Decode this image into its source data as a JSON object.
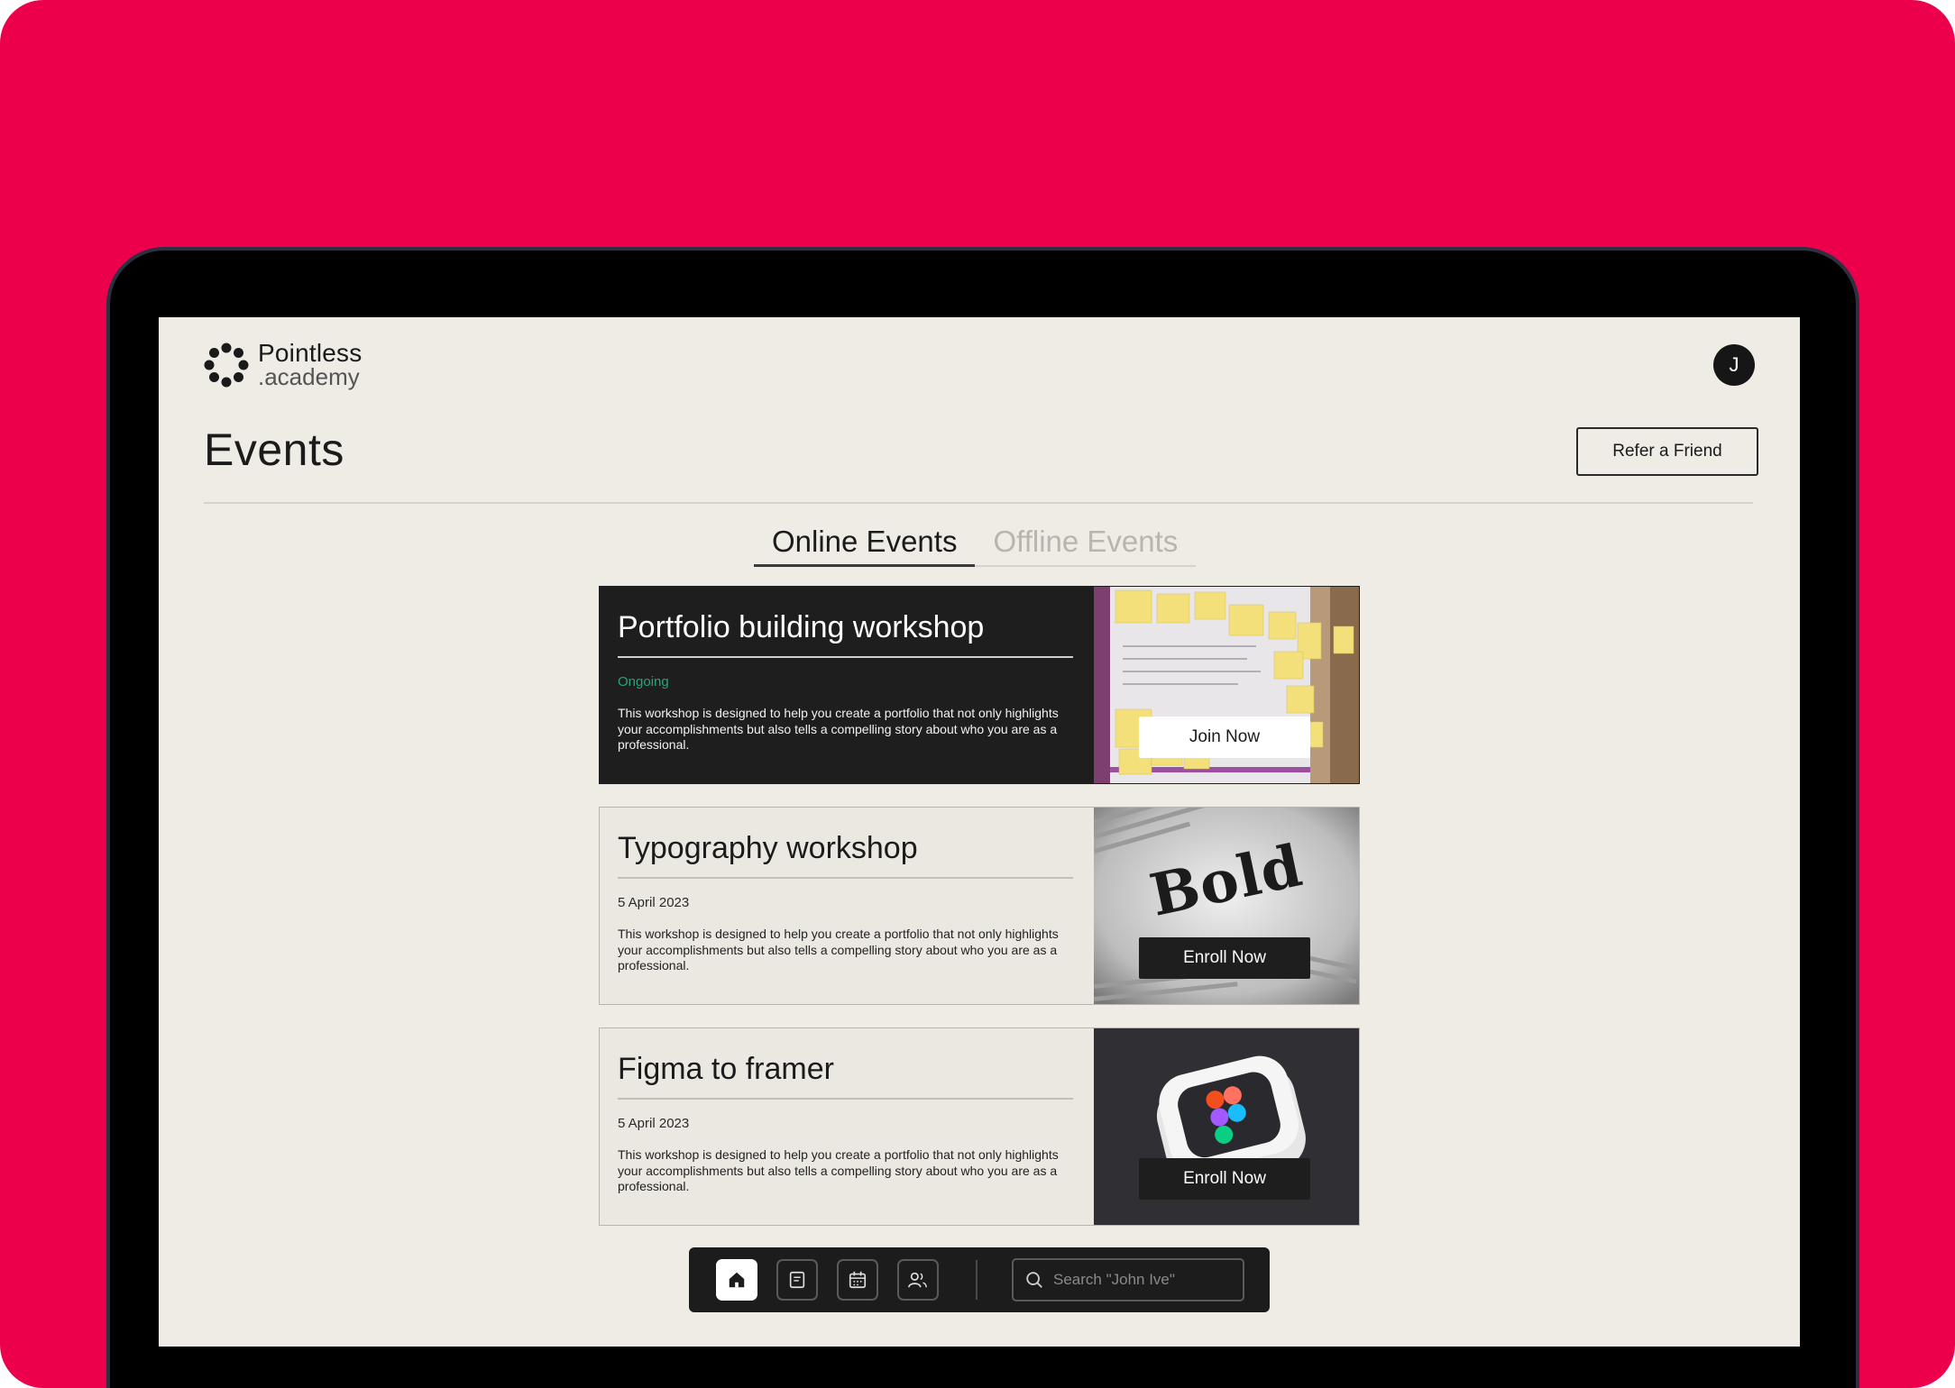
{
  "brand": {
    "name_line1": "Pointless",
    "name_line2": ".academy"
  },
  "user": {
    "initial": "J"
  },
  "header": {
    "title": "Events",
    "refer_label": "Refer a Friend"
  },
  "tabs": [
    {
      "label": "Online Events",
      "active": true
    },
    {
      "label": "Offline Events",
      "active": false
    }
  ],
  "events": [
    {
      "title": "Portfolio building workshop",
      "meta": "Ongoing",
      "description": "This workshop is designed to help you create a portfolio that not only highlights your accomplishments but also tells a compelling story about who you are as a professional.",
      "button": "Join Now"
    },
    {
      "title": "Typography workshop",
      "meta": "5 April 2023",
      "description": "This workshop is designed to help you create a portfolio that not only highlights your accomplishments but also tells a compelling story about who you are as a professional.",
      "button": "Enroll Now",
      "image_word": "Bold"
    },
    {
      "title": "Figma to framer",
      "meta": "5 April 2023",
      "description": "This workshop is designed to help you create a portfolio that not only highlights your accomplishments but also tells a compelling story about who you are as a professional.",
      "button": "Enroll Now"
    }
  ],
  "dock": {
    "items": [
      "home-icon",
      "document-icon",
      "calendar-icon",
      "users-icon"
    ],
    "search_placeholder": "Search \"John Ive\""
  },
  "colors": {
    "background": "#ec004c",
    "screen": "#efebe5",
    "ongoing": "#2aa37a"
  }
}
